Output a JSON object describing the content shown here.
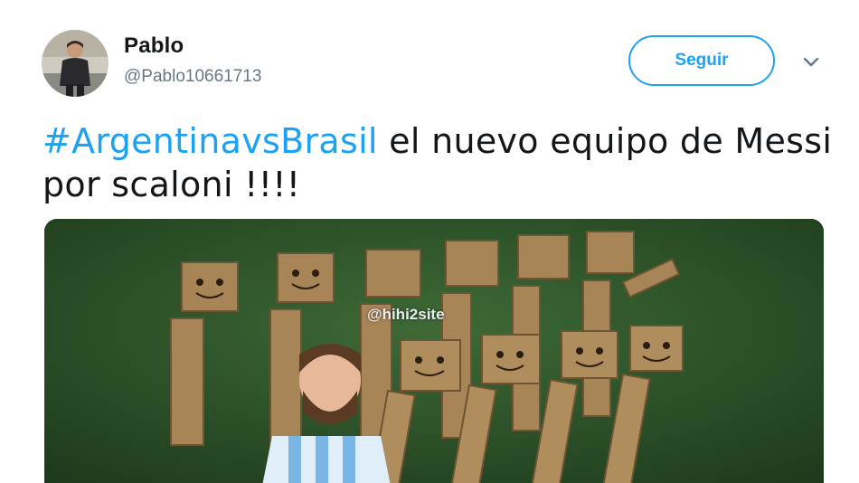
{
  "user": {
    "name": "Pablo",
    "handle": "@Pablo10661713",
    "avatar_icon": "user-avatar"
  },
  "follow_button": {
    "label": "Seguir"
  },
  "menu": {
    "icon": "chevron-down-icon"
  },
  "tweet": {
    "hashtag": "#ArgentinavsBrasil",
    "text": " el nuevo equipo de Messi por scaloni !!!!"
  },
  "media": {
    "watermark": "@hihi2site"
  },
  "colors": {
    "accent": "#1da1f2",
    "text": "#14171a",
    "muted": "#657786"
  }
}
